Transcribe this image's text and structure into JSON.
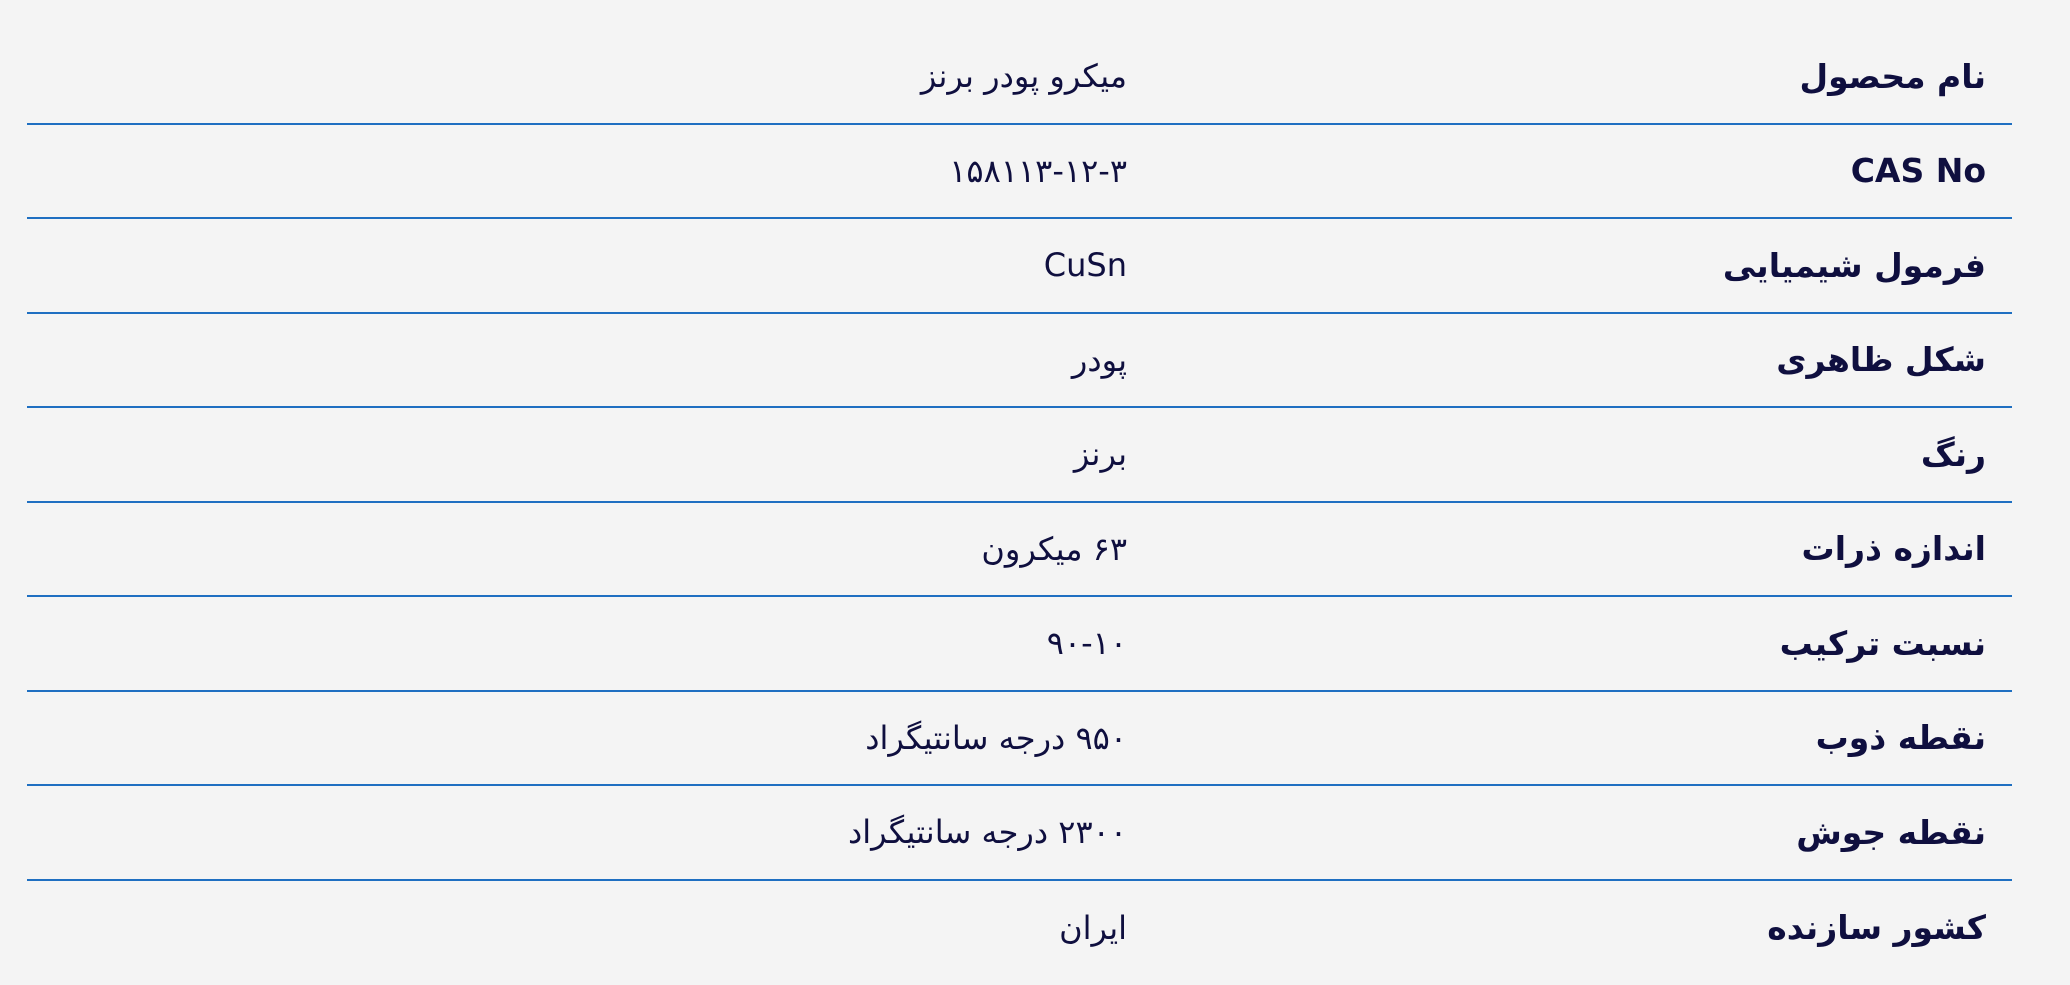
{
  "colors": {
    "text": "#0f0f3f",
    "divider": "#1f6fc1",
    "background": "#f4f4f4"
  },
  "specs": [
    {
      "label": "نام محصول",
      "value": "میکرو پودر برنز"
    },
    {
      "label": "CAS No",
      "value": "۱۵۸۱۱۳-۱۲-۳"
    },
    {
      "label": "فرمول شیمیایی",
      "value": "CuSn"
    },
    {
      "label": "شکل ظاهری",
      "value": "پودر"
    },
    {
      "label": "رنگ",
      "value": "برنز"
    },
    {
      "label": "اندازه ذرات",
      "value": "۶۳ میکرون"
    },
    {
      "label": "نسبت ترکیب",
      "value": "۹۰-۱۰"
    },
    {
      "label": "نقطه ذوب",
      "value": "۹۵۰ درجه سانتیگراد"
    },
    {
      "label": "نقطه جوش",
      "value": "۲۳۰۰ درجه سانتیگراد"
    },
    {
      "label": "کشور سازنده",
      "value": "ایران"
    }
  ]
}
